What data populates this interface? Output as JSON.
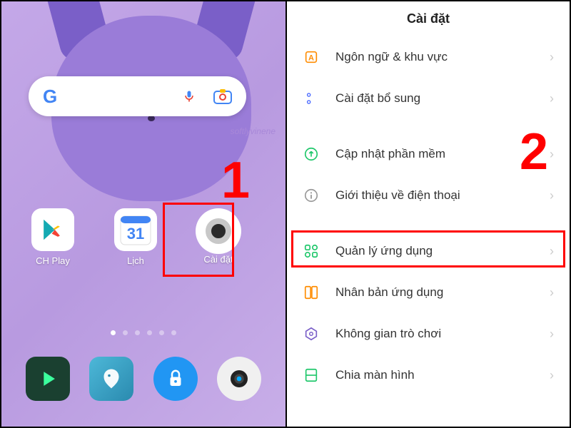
{
  "left": {
    "watermark": "softlyvinene",
    "apps": {
      "play": "CH Play",
      "calendar": "Lịch",
      "calendar_day": "31",
      "settings": "Cài đặt"
    },
    "step": "1"
  },
  "right": {
    "title": "Cài đặt",
    "step": "2",
    "items": [
      {
        "label": "Ngôn ngữ & khu vực",
        "icon": "language"
      },
      {
        "label": "Cài đặt bổ sung",
        "icon": "additional"
      },
      {
        "label": "Cập nhật phần mềm",
        "icon": "update"
      },
      {
        "label": "Giới thiệu về điện thoại",
        "icon": "about"
      },
      {
        "label": "Quản lý ứng dụng",
        "icon": "apps"
      },
      {
        "label": "Nhân bản ứng dụng",
        "icon": "clone"
      },
      {
        "label": "Không gian trò chơi",
        "icon": "game"
      },
      {
        "label": "Chia màn hình",
        "icon": "split"
      }
    ]
  }
}
